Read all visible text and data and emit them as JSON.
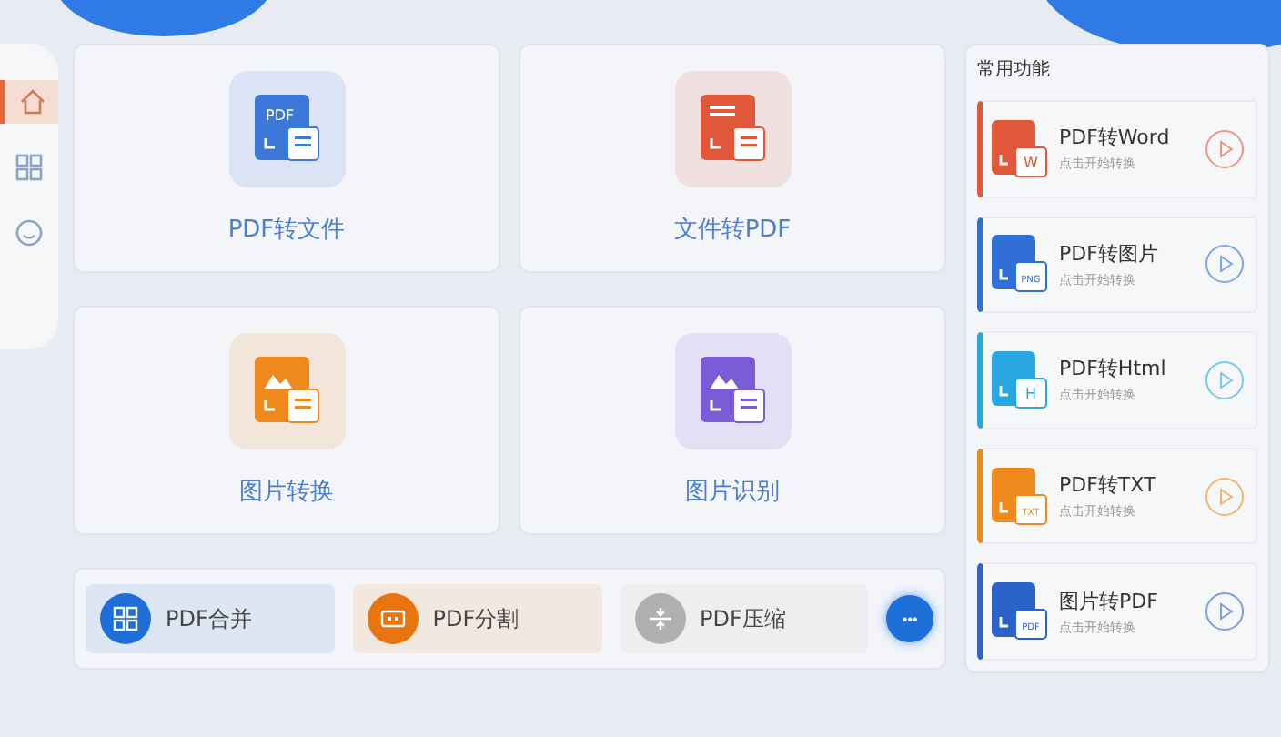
{
  "sidebar": {
    "items": [
      {
        "kind": "home",
        "selected": true
      },
      {
        "kind": "grid",
        "selected": false
      },
      {
        "kind": "smile",
        "selected": false
      }
    ]
  },
  "cards": [
    {
      "label": "PDF转文件",
      "kind": "pdf",
      "color": "#3b78d8",
      "icon_text": "PDF"
    },
    {
      "label": "文件转PDF",
      "kind": "file",
      "color": "#e0573a"
    },
    {
      "label": "图片转换",
      "kind": "image",
      "color": "#ee8a1d"
    },
    {
      "label": "图片识别",
      "kind": "scan",
      "color": "#7b5bd6"
    }
  ],
  "tools": [
    {
      "label": "PDF合并",
      "kind": "merge",
      "color": "#1f6fd8"
    },
    {
      "label": "PDF分割",
      "kind": "split",
      "color": "#e8750f"
    },
    {
      "label": "PDF压缩",
      "kind": "compress",
      "color": "#b0b0b0"
    }
  ],
  "more_label": "•••",
  "panel": {
    "title": "常用功能",
    "items": [
      {
        "title": "PDF转Word",
        "subtitle": "点击开始转换",
        "badge": "W",
        "color": "#e0573a"
      },
      {
        "title": "PDF转图片",
        "subtitle": "点击开始转换",
        "badge": "PNG",
        "color": "#2f6fd6"
      },
      {
        "title": "PDF转Html",
        "subtitle": "点击开始转换",
        "badge": "H",
        "color": "#2aa7e0"
      },
      {
        "title": "PDF转TXT",
        "subtitle": "点击开始转换",
        "badge": "TXT",
        "color": "#ee8a1d"
      },
      {
        "title": "图片转PDF",
        "subtitle": "点击开始转换",
        "badge": "PDF",
        "color": "#2c63c9"
      }
    ]
  }
}
